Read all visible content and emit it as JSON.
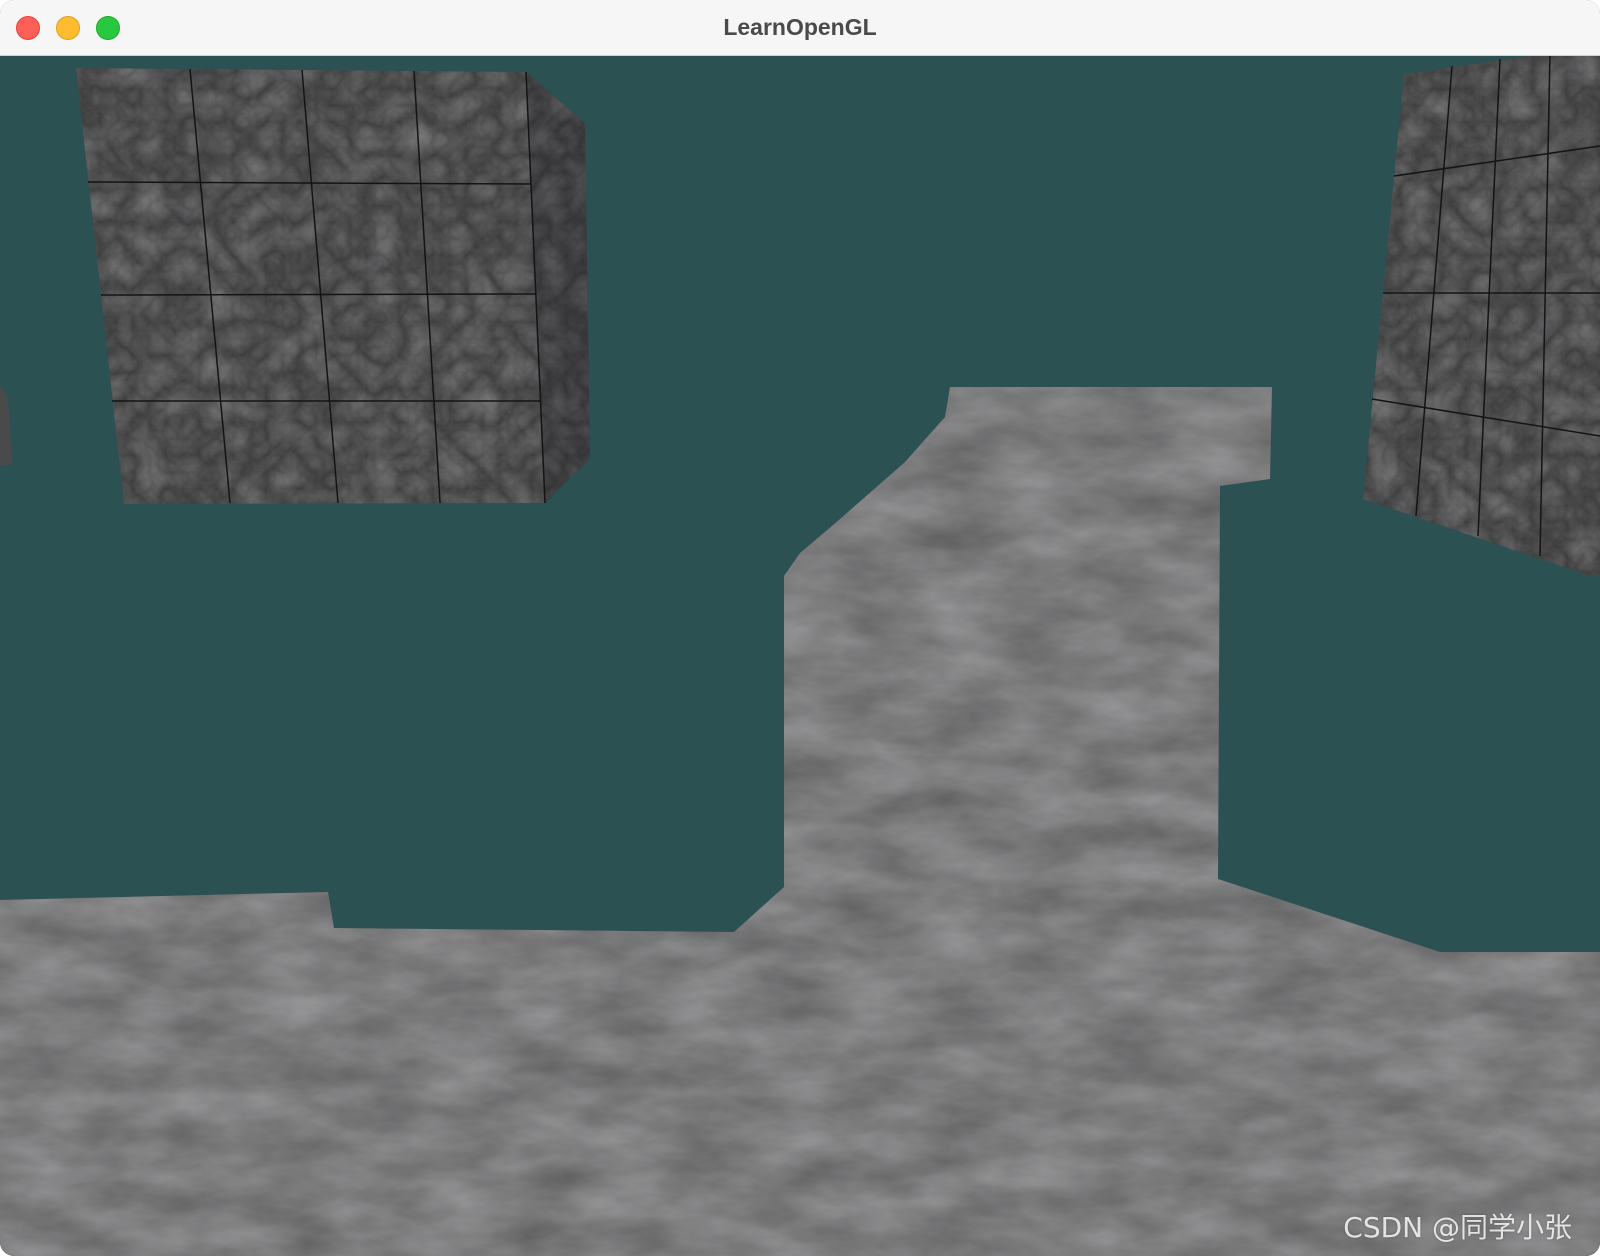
{
  "window": {
    "title": "LearnOpenGL",
    "controls": [
      {
        "name": "close-button",
        "icon": "close-icon",
        "color": "#fe5f57"
      },
      {
        "name": "minimize-button",
        "icon": "minimize-icon",
        "color": "#febc2e"
      },
      {
        "name": "maximize-button",
        "icon": "maximize-icon",
        "color": "#28c840"
      }
    ]
  },
  "scene": {
    "clear_color": "#2b5152",
    "floor_color": "#5e5e5f",
    "cube_color": "#3c3c3d"
  },
  "watermark": "CSDN @同学小张"
}
